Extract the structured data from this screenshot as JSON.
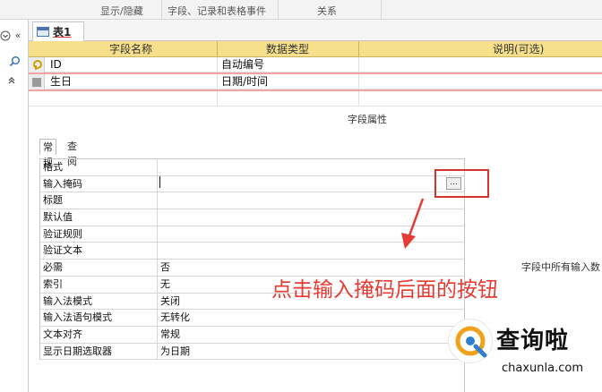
{
  "ribbon": {
    "groups": [
      "显示/隐藏",
      "字段、记录和表格事件",
      "关系"
    ]
  },
  "navpane": {
    "collapse_label": "«",
    "expand_label": "»"
  },
  "document_tab": {
    "label": "表1"
  },
  "grid": {
    "headers": [
      "字段名称",
      "数据类型",
      "说明(可选)"
    ],
    "rows": [
      {
        "name": "ID",
        "type": "自动编号",
        "desc": "",
        "primary_key": true
      },
      {
        "name": "生日",
        "type": "日期/时间",
        "desc": "",
        "primary_key": false
      }
    ]
  },
  "field_properties": {
    "title": "字段属性",
    "tabs": [
      "常规",
      "查阅"
    ],
    "rows": [
      {
        "name": "格式",
        "value": ""
      },
      {
        "name": "输入掩码",
        "value": ""
      },
      {
        "name": "标题",
        "value": ""
      },
      {
        "name": "默认值",
        "value": ""
      },
      {
        "name": "验证规则",
        "value": ""
      },
      {
        "name": "验证文本",
        "value": ""
      },
      {
        "name": "必需",
        "value": "否"
      },
      {
        "name": "索引",
        "value": "无"
      },
      {
        "name": "输入法模式",
        "value": "关闭"
      },
      {
        "name": "输入法语句模式",
        "value": "无转化"
      },
      {
        "name": "文本对齐",
        "value": "常规"
      },
      {
        "name": "显示日期选取器",
        "value": "为日期"
      }
    ],
    "builder_button_label": "...",
    "hint_text": "字段中所有输入数"
  },
  "annotation": {
    "text": "点击输入掩码后面的按钮",
    "color": "#e53b32"
  },
  "watermark": {
    "title": "查询啦",
    "subtitle": "chaxunla.com"
  }
}
